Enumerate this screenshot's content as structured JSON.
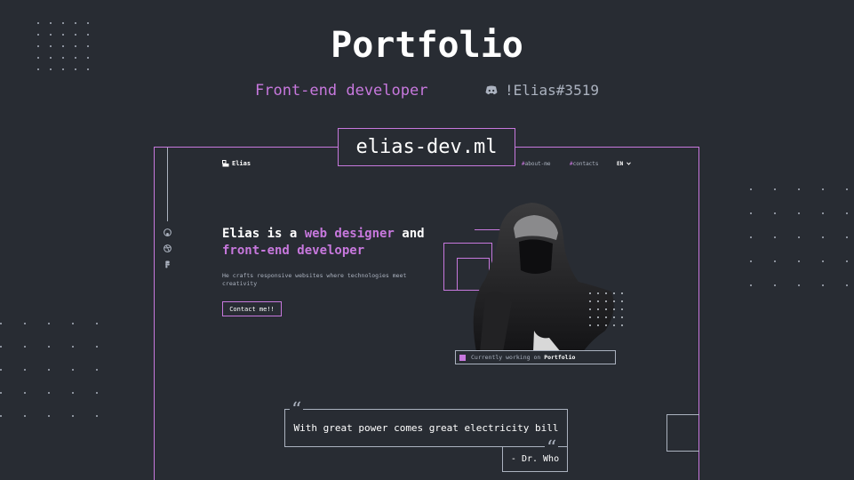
{
  "page_title": "Portfolio",
  "role": "Front-end developer",
  "discord": {
    "icon": "discord-icon",
    "handle": "!Elias#3519"
  },
  "domain": "elias-dev.ml",
  "site": {
    "logo": {
      "icon": "logo-icon",
      "text": "Elias"
    },
    "nav": [
      {
        "hash": "#",
        "label": "about-me"
      },
      {
        "hash": "#",
        "label": "contacts"
      }
    ],
    "lang": "EN",
    "social_icons": [
      "github-icon",
      "dribbble-icon",
      "figma-icon"
    ],
    "hero": {
      "part1": "Elias is a ",
      "highlight1": "web designer",
      "part2": " and",
      "highlight2": "front-end developer",
      "subtext": "He crafts responsive websites where technologies meet creativity",
      "contact_button": "Contact me!!"
    },
    "status": {
      "prefix": "Currently working on ",
      "project": "Portfolio"
    },
    "quote": {
      "text": "With great power comes great electricity bill",
      "author": "- Dr. Who"
    }
  },
  "colors": {
    "background": "#282c33",
    "accent": "#c778dd",
    "text": "#abb2bf",
    "white": "#ffffff"
  }
}
